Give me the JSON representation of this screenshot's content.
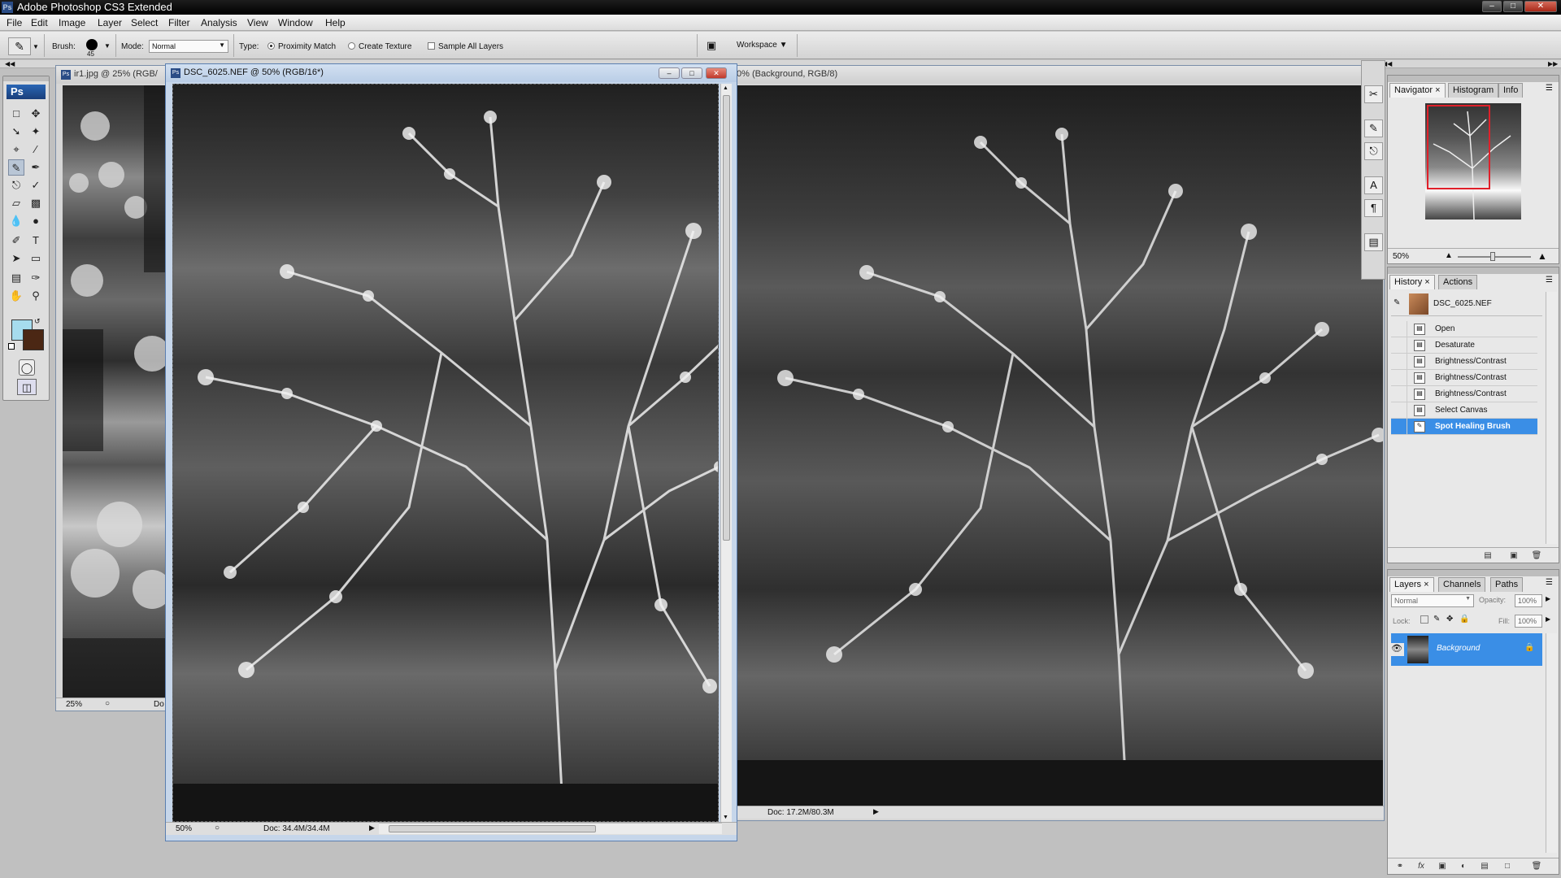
{
  "app": {
    "title": "Adobe Photoshop CS3 Extended",
    "icon_label": "Ps",
    "window_buttons": [
      "–",
      "□",
      "✕"
    ]
  },
  "menu": [
    "File",
    "Edit",
    "Image",
    "Layer",
    "Select",
    "Filter",
    "Analysis",
    "View",
    "Window",
    "Help"
  ],
  "options": {
    "brush_label": "Brush:",
    "brush_size": "45",
    "mode_label": "Mode:",
    "mode_value": "Normal",
    "type_label": "Type:",
    "type_options": [
      "Proximity Match",
      "Create Texture"
    ],
    "type_selected": "Proximity Match",
    "sample_all_layers": "Sample All Layers",
    "workspace_label": "Workspace"
  },
  "toolbox": {
    "logo": "Ps",
    "fg_color": "#a6dcee",
    "bg_color": "#4b2714"
  },
  "documents": {
    "left": {
      "title": "ir1.jpg @ 25% (RGB/",
      "zoom": "25%",
      "doc": "Do"
    },
    "active": {
      "title": "DSC_6025.NEF @ 50% (RGB/16*)",
      "zoom": "50%",
      "doc": "Doc: 34.4M/34.4M"
    },
    "right": {
      "title": "0% (Background, RGB/8)",
      "doc": "Doc: 17.2M/80.3M"
    }
  },
  "navigator": {
    "tabs": [
      "Navigator",
      "Histogram",
      "Info"
    ],
    "zoom": "50%"
  },
  "history": {
    "tabs": [
      "History",
      "Actions"
    ],
    "snapshot": "DSC_6025.NEF",
    "items": [
      "Open",
      "Desaturate",
      "Brightness/Contrast",
      "Brightness/Contrast",
      "Brightness/Contrast",
      "Select Canvas",
      "Spot Healing Brush"
    ],
    "selected_index": 6
  },
  "layers": {
    "tabs": [
      "Layers",
      "Channels",
      "Paths"
    ],
    "blend_mode": "Normal",
    "opacity_label": "Opacity:",
    "opacity": "100%",
    "lock_label": "Lock:",
    "fill_label": "Fill:",
    "fill": "100%",
    "layer_name": "Background"
  },
  "colors": {
    "selection": "#3a8ee6",
    "accent": "#2a66b5"
  }
}
